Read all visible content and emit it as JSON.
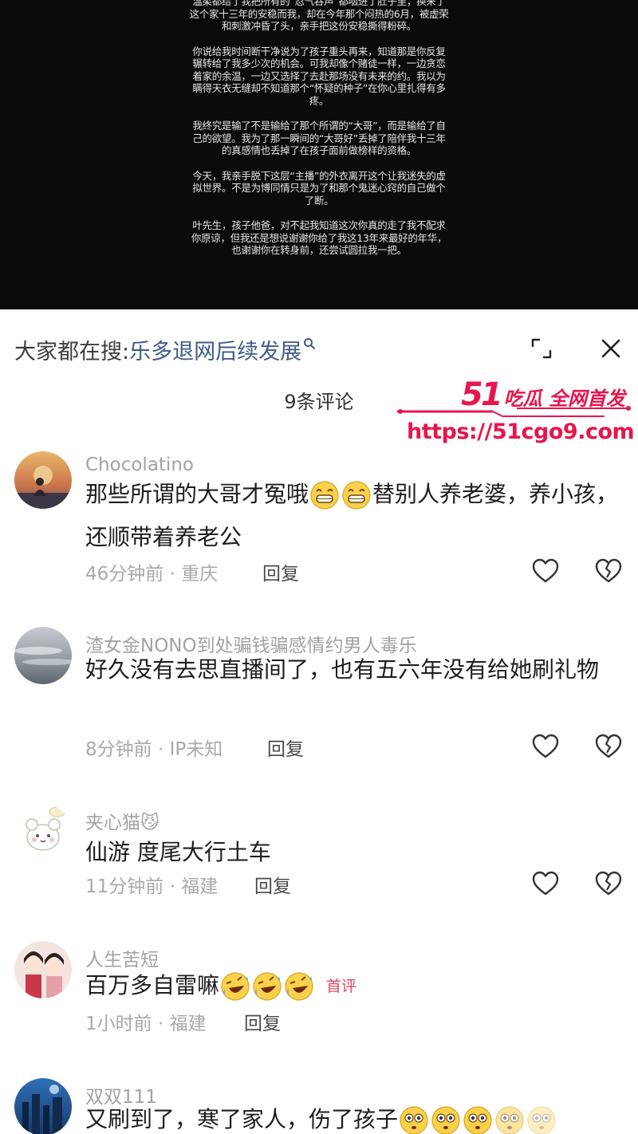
{
  "video": {
    "paragraphs": [
      "温柔都给了我把所有的“忍气吞声”都咽进了肚子里，换来了这个家十三年的安稳而我，却在今年那个闷热的6月，被虚荣和刺激冲昏了头，亲手把这份安稳撕得粉碎。",
      "你说给我时间断干净说为了孩子重头再来，知道那是你反复辗转给了我多少次的机会。可我却像个赌徒一样，一边贪恋着家的余温，一边又选择了去赴那场没有未来的约。我以为瞒得天衣无缝却不知道那个“怀疑的种子”在你心里扎得有多疼。",
      "我终究是输了不是输给了那个所谓的“大哥”，而是输给了自己的欲望。我为了那一瞬间的“大哥好”丢掉了陪伴我十三年的真感情也丢掉了在孩子面前做榜样的资格。",
      "今天，我亲手脱下这层“主播”的外衣离开这个让我迷失的虚拟世界。不是为博同情只是为了和那个鬼迷心窍的自己做个了断。",
      "叶先生，孩子他爸，对不起我知道这次你真的走了我不配求你原谅，但我还是想说谢谢你给了我这13年来最好的年华，也谢谢你在转身前，还尝试圆拉我一把。"
    ]
  },
  "search": {
    "prefix": "大家都在搜:",
    "term": "乐多退网后续发展",
    "icon": "search-icon"
  },
  "header": {
    "count_label": "9条评论"
  },
  "watermark": {
    "brand_num": "51",
    "brand_text": "吃瓜 全网首发",
    "url": "https://51cgo9.com",
    "color": "#e8154c"
  },
  "comments": [
    {
      "username": "Chocolatino",
      "text": "那些所谓的大哥才冤哦😁😁替别人养老婆，养小孩，还顺带着养老公",
      "time_location": "46分钟前 · 重庆",
      "reply_label": "回复"
    },
    {
      "username": "渣女金NONO到处骗钱骗感情约男人毒乐",
      "text": "好久没有去思直播间了，也有五六年没有给她刷礼物",
      "time_location": "8分钟前 · IP未知",
      "reply_label": "回复"
    },
    {
      "username": "夹心猫😼",
      "text": "仙游 度尾大行土车",
      "time_location": "11分钟前 · 福建",
      "reply_label": "回复"
    },
    {
      "username": "人生苦短",
      "text": "百万多自雷嘛🤣🤣🤣",
      "badge": "首评",
      "time_location": "1小时前 · 福建",
      "reply_label": "回复"
    },
    {
      "username": "双双111",
      "text": "又刷到了，寒了家人，伤了孩子😳😳😳😳😳"
    }
  ],
  "colors": {
    "link": "#3f5a8a",
    "badge": "#e2485e",
    "video_bg": "#0b0b0d"
  }
}
